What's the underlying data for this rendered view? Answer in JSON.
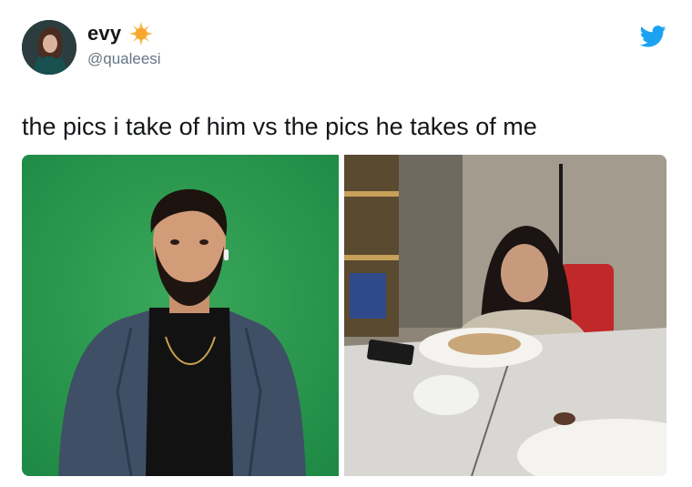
{
  "author": {
    "display_name": "evy",
    "handle": "@qualeesi",
    "badge_icon": "sun-emoji-icon",
    "avatar_icon": "user-avatar"
  },
  "platform": {
    "logo_icon": "twitter-bird-icon",
    "brand_color": "#1da1f2"
  },
  "tweet": {
    "text": "the pics i take of him vs the pics he takes of me"
  },
  "media": {
    "images": [
      {
        "name": "photo-left",
        "subject": "man-posing-green-screen"
      },
      {
        "name": "photo-right",
        "subject": "girl-eating-at-table"
      }
    ]
  }
}
